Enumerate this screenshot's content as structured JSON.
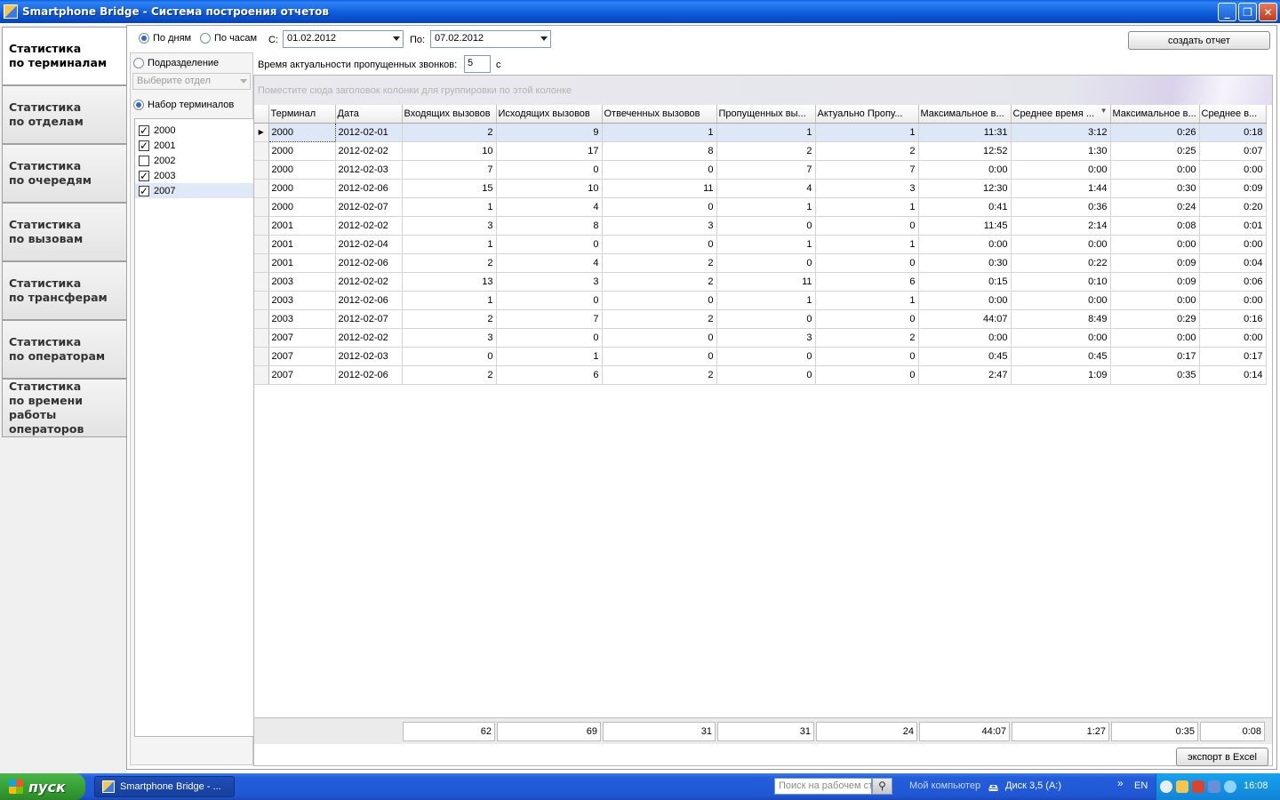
{
  "window": {
    "title": "Smartphone Bridge - Система построения отчетов",
    "minimize": "_",
    "restore": "❐",
    "close": "✕"
  },
  "nav": {
    "tabs": [
      {
        "line1": "Статистика",
        "line2": "по терминалам",
        "line3": ""
      },
      {
        "line1": "Статистика",
        "line2": "по отделам",
        "line3": ""
      },
      {
        "line1": "Статистика",
        "line2": "по очередям",
        "line3": ""
      },
      {
        "line1": "Статистика",
        "line2": "по вызовам",
        "line3": ""
      },
      {
        "line1": "Статистика",
        "line2": "по трансферам",
        "line3": ""
      },
      {
        "line1": "Статистика",
        "line2": "по операторам",
        "line3": ""
      },
      {
        "line1": "Статистика",
        "line2": "по времени работы",
        "line3": "операторов"
      }
    ]
  },
  "controls": {
    "by_days": "По дням",
    "by_hours": "По часам",
    "from_label": "С:",
    "from_value": "01.02.2012",
    "to_label": "По:",
    "to_value": "07.02.2012",
    "create_report": "создать отчет",
    "actuality_label": "Время актуальности пропущенных звонков:",
    "actuality_value": "5",
    "actuality_unit": "с",
    "export": "экспорт в Excel"
  },
  "filter": {
    "department_label": "Подразделение",
    "department_placeholder": "Выберите отдел",
    "terminals_label": "Набор терминалов",
    "terminals": [
      {
        "label": "2000",
        "checked": "✓"
      },
      {
        "label": "2001",
        "checked": "✓"
      },
      {
        "label": "2002",
        "checked": ""
      },
      {
        "label": "2003",
        "checked": "✓"
      },
      {
        "label": "2007",
        "checked": "✓"
      }
    ]
  },
  "grid": {
    "group_hint": "Поместите сюда заголовок колонки для группировки по этой колонке",
    "columns": [
      "Терминал",
      "Дата",
      "Входящих вызовов",
      "Исходящих вызовов",
      "Отвеченных вызовов",
      "Пропущенных вы...",
      "Актуально Пропу...",
      "Максимальное в...",
      "Среднее время ...",
      "Максимальное в...",
      "Среднее в..."
    ],
    "rows": [
      [
        "2000",
        "2012-02-01",
        "2",
        "9",
        "1",
        "1",
        "1",
        "11:31",
        "3:12",
        "0:26",
        "0:18"
      ],
      [
        "2000",
        "2012-02-02",
        "10",
        "17",
        "8",
        "2",
        "2",
        "12:52",
        "1:30",
        "0:25",
        "0:07"
      ],
      [
        "2000",
        "2012-02-03",
        "7",
        "0",
        "0",
        "7",
        "7",
        "0:00",
        "0:00",
        "0:00",
        "0:00"
      ],
      [
        "2000",
        "2012-02-06",
        "15",
        "10",
        "11",
        "4",
        "3",
        "12:30",
        "1:44",
        "0:30",
        "0:09"
      ],
      [
        "2000",
        "2012-02-07",
        "1",
        "4",
        "0",
        "1",
        "1",
        "0:41",
        "0:36",
        "0:24",
        "0:20"
      ],
      [
        "2001",
        "2012-02-02",
        "3",
        "8",
        "3",
        "0",
        "0",
        "11:45",
        "2:14",
        "0:08",
        "0:01"
      ],
      [
        "2001",
        "2012-02-04",
        "1",
        "0",
        "0",
        "1",
        "1",
        "0:00",
        "0:00",
        "0:00",
        "0:00"
      ],
      [
        "2001",
        "2012-02-06",
        "2",
        "4",
        "2",
        "0",
        "0",
        "0:30",
        "0:22",
        "0:09",
        "0:04"
      ],
      [
        "2003",
        "2012-02-02",
        "13",
        "3",
        "2",
        "11",
        "6",
        "0:15",
        "0:10",
        "0:09",
        "0:06"
      ],
      [
        "2003",
        "2012-02-06",
        "1",
        "0",
        "0",
        "1",
        "1",
        "0:00",
        "0:00",
        "0:00",
        "0:00"
      ],
      [
        "2003",
        "2012-02-07",
        "2",
        "7",
        "2",
        "0",
        "0",
        "44:07",
        "8:49",
        "0:29",
        "0:16"
      ],
      [
        "2007",
        "2012-02-02",
        "3",
        "0",
        "0",
        "3",
        "2",
        "0:00",
        "0:00",
        "0:00",
        "0:00"
      ],
      [
        "2007",
        "2012-02-03",
        "0",
        "1",
        "0",
        "0",
        "0",
        "0:45",
        "0:45",
        "0:17",
        "0:17"
      ],
      [
        "2007",
        "2012-02-06",
        "2",
        "6",
        "2",
        "0",
        "0",
        "2:47",
        "1:09",
        "0:35",
        "0:14"
      ]
    ],
    "totals": [
      "62",
      "69",
      "31",
      "31",
      "24",
      "44:07",
      "1:27",
      "0:35",
      "0:08"
    ]
  },
  "taskbar": {
    "start": "пуск",
    "task": "Smartphone Bridge - ...",
    "search_placeholder": "Поиск на рабочем ст",
    "my_computer": "Мой компьютер",
    "disk": "Диск 3,5 (A:)",
    "chevron": "»",
    "lang": "EN",
    "clock": "16:08"
  }
}
